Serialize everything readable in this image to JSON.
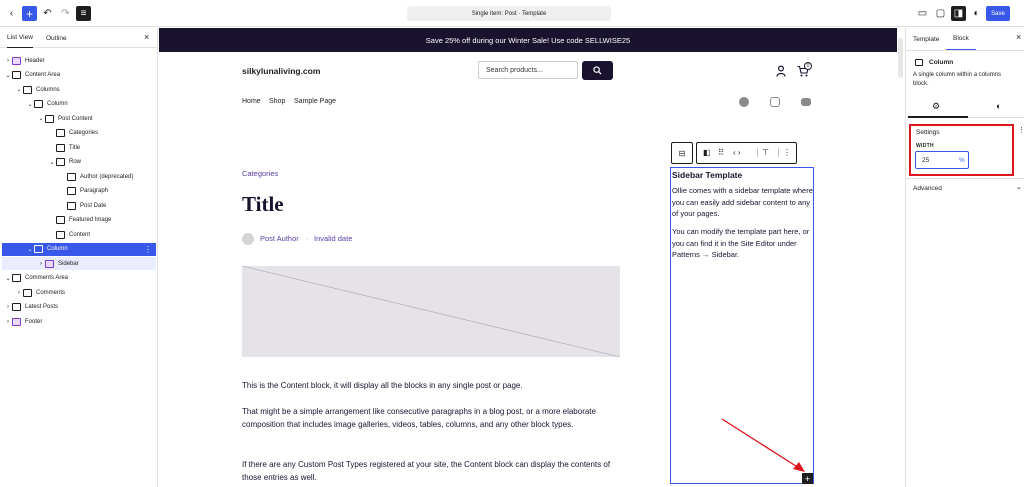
{
  "topbar": {
    "document_title": "Single item: Post · Template",
    "save_label": "Save",
    "icons": [
      "back-icon",
      "add-icon",
      "undo-icon",
      "redo-icon",
      "document-overview-icon",
      "desktop-preview-icon",
      "settings-toggle-icon",
      "styles-icon",
      "options-icon"
    ]
  },
  "left_panel": {
    "tabs": [
      "List View",
      "Outline"
    ],
    "close_label": "×",
    "tree": [
      {
        "label": "Header",
        "depth": 0,
        "chev": "›",
        "icon": "template-part",
        "color": "purple"
      },
      {
        "label": "Content Area",
        "depth": 0,
        "chev": "⌄",
        "icon": "group"
      },
      {
        "label": "Columns",
        "depth": 1,
        "chev": "⌄",
        "icon": "columns"
      },
      {
        "label": "Column",
        "depth": 2,
        "chev": "⌄",
        "icon": "column"
      },
      {
        "label": "Post Content",
        "depth": 3,
        "chev": "⌄",
        "icon": "post-content"
      },
      {
        "label": "Categories",
        "depth": 4,
        "chev": "",
        "icon": "categories"
      },
      {
        "label": "Title",
        "depth": 4,
        "chev": "",
        "icon": "title"
      },
      {
        "label": "Row",
        "depth": 4,
        "chev": "⌄",
        "icon": "row"
      },
      {
        "label": "Author (deprecated)",
        "depth": 5,
        "chev": "",
        "icon": "author"
      },
      {
        "label": "Paragraph",
        "depth": 5,
        "chev": "",
        "icon": "paragraph"
      },
      {
        "label": "Post Date",
        "depth": 5,
        "chev": "",
        "icon": "date"
      },
      {
        "label": "Featured Image",
        "depth": 4,
        "chev": "",
        "icon": "image"
      },
      {
        "label": "Content",
        "depth": 4,
        "chev": "",
        "icon": "content"
      },
      {
        "label": "Column",
        "depth": 2,
        "chev": "⌄",
        "icon": "column",
        "selected": true
      },
      {
        "label": "Sidebar",
        "depth": 3,
        "chev": "›",
        "icon": "template-part",
        "color": "purple",
        "child_selected": true
      },
      {
        "label": "Comments Area",
        "depth": 0,
        "chev": "⌄",
        "icon": "group"
      },
      {
        "label": "Comments",
        "depth": 1,
        "chev": "›",
        "icon": "comments"
      },
      {
        "label": "Latest Posts",
        "depth": 0,
        "chev": "›",
        "icon": "group"
      },
      {
        "label": "Footer",
        "depth": 0,
        "chev": "›",
        "icon": "template-part",
        "color": "purple"
      }
    ]
  },
  "canvas": {
    "banner_text": "Save 25% off during our Winter Sale! Use code SELLWISE25",
    "site_title": "silkylunaliving.com",
    "search_placeholder": "Search products...",
    "cart_count": "0",
    "nav": [
      "Home",
      "Shop",
      "Sample Page"
    ],
    "category_link": "Categories",
    "post_title": "Title",
    "post_author": "Post Author",
    "post_separator": "·",
    "post_date": "Invalid date",
    "paragraphs": [
      "This is the Content block, it will display all the blocks in any single post or page.",
      "That might be a simple arrangement like consecutive paragraphs in a blog post, or a more elaborate composition that includes image galleries, videos, tables, columns, and any other block types.",
      "If there are any Custom Post Types registered at your site, the Content block can display the contents of those entries as well."
    ],
    "sidebar": {
      "title": "Sidebar Template",
      "p1": "Ollie comes with a sidebar template where you can easily add sidebar content to any of your pages.",
      "p2": "You can modify the template part here, or you can find it in the Site Editor under Patterns → Sidebar."
    }
  },
  "right_panel": {
    "tabs": [
      "Template",
      "Block"
    ],
    "close_label": "×",
    "block_name": "Column",
    "block_description": "A single column within a columns block.",
    "settings_label": "Settings",
    "width_label": "WIDTH",
    "width_value": "25",
    "width_unit": "%",
    "advanced_label": "Advanced"
  },
  "colors": {
    "accent": "#3858e9",
    "banner": "#1a1330",
    "link": "#5b3ea8",
    "highlight_box": "#e0141e",
    "annotation_arrow": "#e0141e"
  }
}
